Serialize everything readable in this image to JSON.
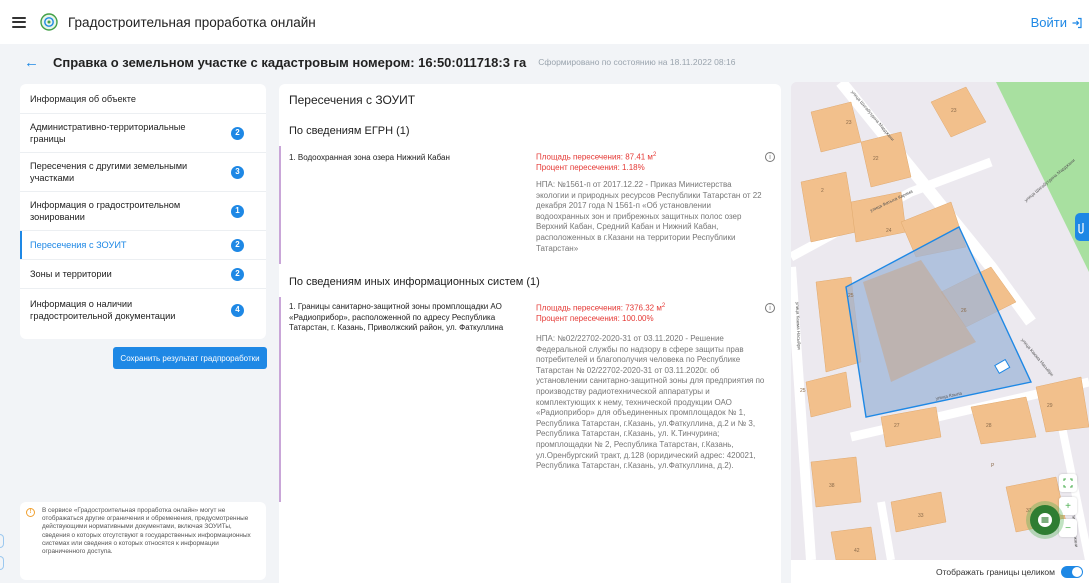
{
  "header": {
    "app_title": "Градостроительная проработка онлайн",
    "login_label": "Войти"
  },
  "subheader": {
    "title": "Справка о земельном участке с кадастровым номером: 16:50:011718:3 га",
    "subtitle": "Сформировано по состоянию на 18.11.2022 08:16"
  },
  "sidebar": {
    "items": [
      {
        "label": "Информация об объекте",
        "count": ""
      },
      {
        "label": "Административно-территориальные границы",
        "count": "2"
      },
      {
        "label": "Пересечения с другими земельными участками",
        "count": "3"
      },
      {
        "label": "Информация о градостроительном зонировании",
        "count": "1"
      },
      {
        "label": "Пересечения с ЗОУИТ",
        "count": "2"
      },
      {
        "label": "Зоны и территории",
        "count": "2"
      },
      {
        "label": "Информация о наличии градостроительной документации",
        "count": "4"
      }
    ],
    "save_label": "Сохранить результат градпроработки"
  },
  "notice": {
    "text": "В сервисе «Градостроительная проработка онлайн» могут не отображаться другие ограничения и обременения, предусмотренные действующими нормативными документами, включая ЗОУИТы, сведения о которых отсутствуют в государственных информационных системах или сведения о которых относятся к информации ограниченного доступа."
  },
  "main": {
    "title": "Пересечения с ЗОУИТ",
    "section1": {
      "title": "По сведениям ЕГРН (1)",
      "name": "1. Водоохранная зона озера Нижний Кабан",
      "area": "Площадь пересечения: 87.41 м",
      "area_unit_sup": "2",
      "percent": "Процент пересечения: 1.18%",
      "npa": "НПА: №1561-п от 2017.12.22 - Приказ Министерства экологии и природных ресурсов Республики Татарстан от 22 декабря 2017 года N 1561-п «Об установлении водоохранных зон и прибрежных защитных полос озер Верхний Кабан, Средний Кабан и Нижний Кабан, расположенных в г.Казани на территории Республики Татарстан»"
    },
    "section2": {
      "title": "По сведениям иных информационных систем (1)",
      "name": "1. Границы санитарно-защитной зоны промплощадки АО «Радиоприбор», расположенной по адресу Республика Татарстан, г. Казань, Приволжский район, ул. Фаткуллина",
      "area": "Площадь пересечения: 7376.32 м",
      "area_unit_sup": "2",
      "percent": "Процент пересечения: 100.00%",
      "npa": "НПА: №02/22702-2020-31 от 03.11.2020 - Решение Федеральной службы по надзору в сфере защиты прав потребителей и благополучия человека по Республике Татарстан № 02/22702-2020-31 от 03.11.2020г. об установлении санитарно-защитной зоны для предприятия по производству радиотехнической аппаратуры и комплектующих к нему, технической продукции ОАО «Радиоприбор» для объединенных промплощадок № 1, Республика Татарстан, г.Казань, ул.Фаткуллина, д.2 и № 3, Республика Татарстан, г.Казань, ул. К.Тинчурина; промплощадки № 2, Республика Татарстан, г.Казань, ул.Оренбургский тракт, д.128 (юридический адрес: 420021, Республика Татарстан, г.Казань, ул.Фаткуллина, д.2)."
    }
  },
  "map": {
    "labels": {
      "street1": "улица Шигабутдина Марджани",
      "street2": "улица Фатыха Карима",
      "street3": "улица Шигабутдина Марджани",
      "street4": "улица Каюма Насыйри",
      "street5": "улица Кзыла",
      "street6": "улица Каюма Насыйри",
      "street7": "улица Марджани"
    },
    "house_numbers": [
      "23",
      "22",
      "2",
      "23",
      "24",
      "25",
      "26",
      "23",
      "23",
      "25",
      "25",
      "27",
      "27",
      "28",
      "29",
      "38",
      "33",
      "P",
      "42",
      "37"
    ],
    "footer_label": "Отображать границы целиком",
    "zoom_in": "+",
    "zoom_out": "−"
  },
  "colors": {
    "accent": "#1e88e5",
    "warning": "#e53935",
    "record_border": "#c9a6d8",
    "map_green": "#4caf50"
  }
}
